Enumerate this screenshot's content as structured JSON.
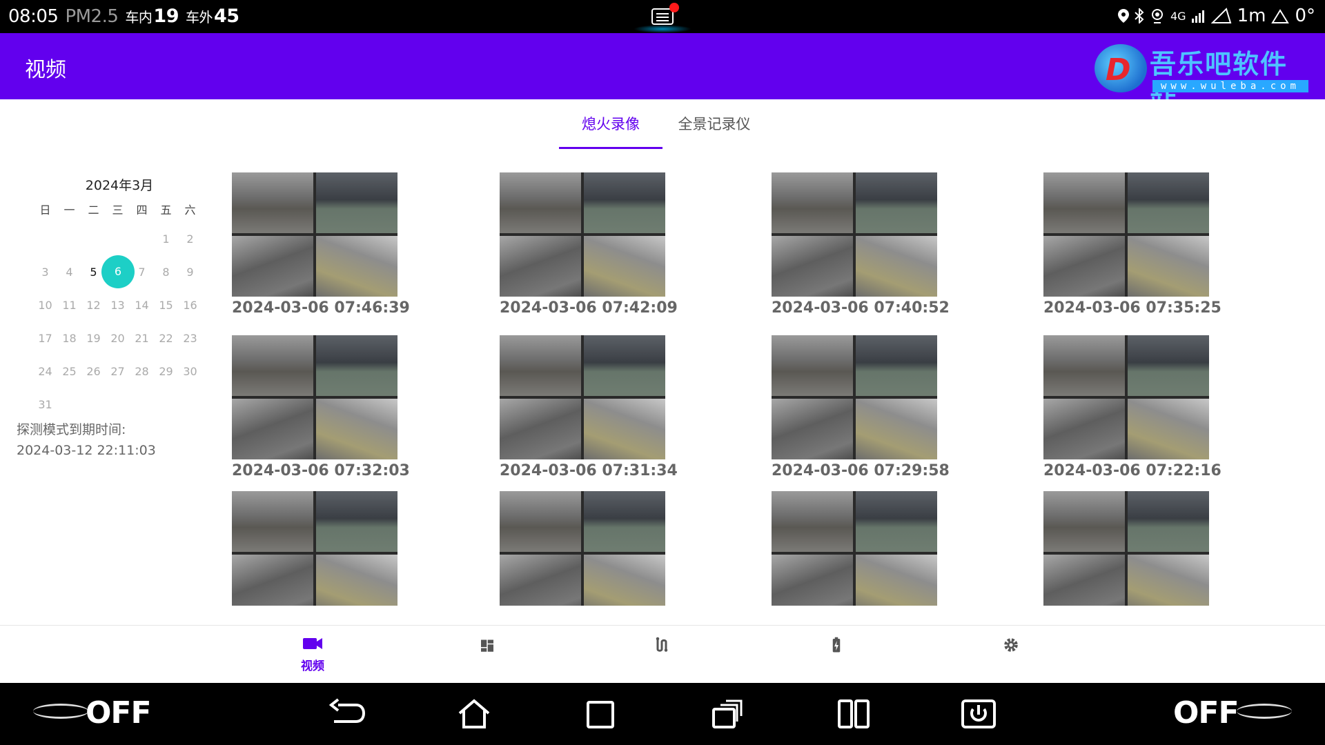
{
  "status_bar": {
    "time": "08:05",
    "pm_label": "PM2.5",
    "inside_label": "车内",
    "inside_value": "19",
    "outside_label": "车外",
    "outside_value": "45",
    "network": "4G",
    "right_text": "1m",
    "right_value": "0°"
  },
  "app_bar": {
    "title": "视频",
    "logo_text": "吾乐吧软件站",
    "logo_url": "www.wuleba.com"
  },
  "tabs": [
    {
      "label": "熄火录像",
      "active": true
    },
    {
      "label": "全景记录仪",
      "active": false
    }
  ],
  "calendar": {
    "title": "2024年3月",
    "weekdays": [
      "日",
      "一",
      "二",
      "三",
      "四",
      "五",
      "六"
    ],
    "weeks": [
      [
        "",
        "",
        "",
        "",
        "",
        "1",
        "2"
      ],
      [
        "3",
        "4",
        "5",
        "6",
        "7",
        "8",
        "9"
      ],
      [
        "10",
        "11",
        "12",
        "13",
        "14",
        "15",
        "16"
      ],
      [
        "17",
        "18",
        "19",
        "20",
        "21",
        "22",
        "23"
      ],
      [
        "24",
        "25",
        "26",
        "27",
        "28",
        "29",
        "30"
      ],
      [
        "31",
        "",
        "",
        "",
        "",
        "",
        ""
      ]
    ],
    "today": "5",
    "selected": "6"
  },
  "expire": {
    "label": "探测模式到期时间:",
    "value": "2024-03-12 22:11:03"
  },
  "videos": [
    {
      "time": "2024-03-06 07:46:39"
    },
    {
      "time": "2024-03-06 07:42:09"
    },
    {
      "time": "2024-03-06 07:40:52"
    },
    {
      "time": "2024-03-06 07:35:25"
    },
    {
      "time": "2024-03-06 07:32:03"
    },
    {
      "time": "2024-03-06 07:31:34"
    },
    {
      "time": "2024-03-06 07:29:58"
    },
    {
      "time": "2024-03-06 07:22:16"
    },
    {
      "time": ""
    },
    {
      "time": ""
    },
    {
      "time": ""
    },
    {
      "time": ""
    }
  ],
  "bottom_nav": {
    "video_label": "视频"
  },
  "system_nav": {
    "left_off": "OFF",
    "right_off": "OFF"
  },
  "colors": {
    "primary": "#6200ee",
    "selected_day": "#1dcfc6"
  }
}
